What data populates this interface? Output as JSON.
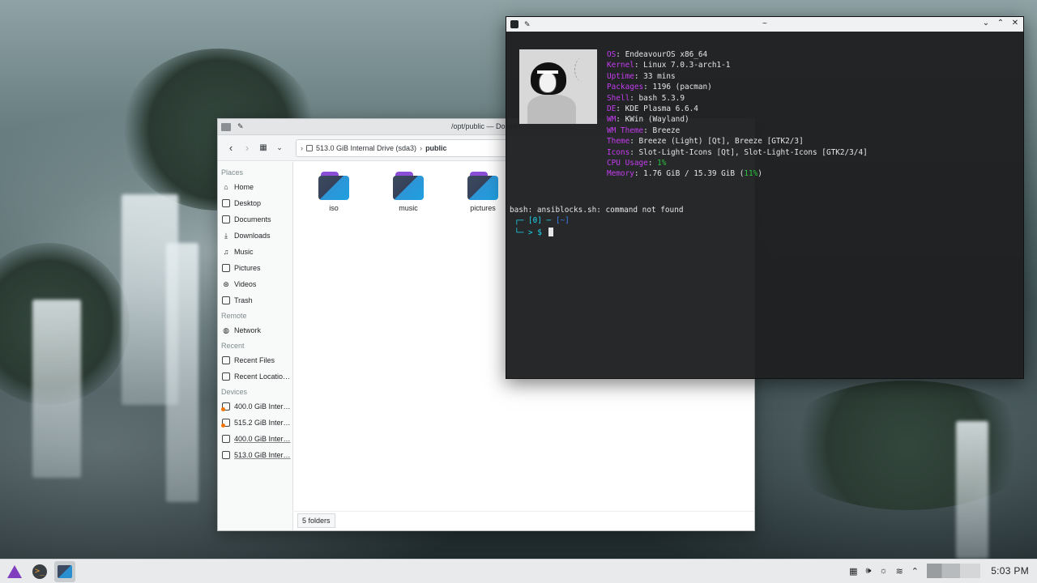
{
  "dolphin": {
    "title": "/opt/public — Dolphin",
    "breadcrumb": {
      "drive": "513.0 GiB Internal Drive (sda3)",
      "current": "public"
    },
    "places": {
      "places_heading": "Places",
      "items": [
        {
          "label": "Home",
          "icon": "home-icon"
        },
        {
          "label": "Desktop",
          "icon": "desktop-icon"
        },
        {
          "label": "Documents",
          "icon": "documents-icon"
        },
        {
          "label": "Downloads",
          "icon": "downloads-icon"
        },
        {
          "label": "Music",
          "icon": "music-icon"
        },
        {
          "label": "Pictures",
          "icon": "pictures-icon"
        },
        {
          "label": "Videos",
          "icon": "videos-icon"
        },
        {
          "label": "Trash",
          "icon": "trash-icon"
        }
      ],
      "remote_heading": "Remote",
      "remote_items": [
        {
          "label": "Network",
          "icon": "network-icon"
        }
      ],
      "recent_heading": "Recent",
      "recent_items": [
        {
          "label": "Recent Files",
          "icon": "recent-files-icon"
        },
        {
          "label": "Recent Locatio…",
          "icon": "recent-locations-icon"
        }
      ],
      "devices_heading": "Devices",
      "devices": [
        {
          "label": "400.0 GiB Inter…",
          "icon": "drive-icon"
        },
        {
          "label": "515.2 GiB Inter…",
          "icon": "drive-icon"
        },
        {
          "label": "400.0 GiB Inter…",
          "icon": "drive-icon"
        },
        {
          "label": "513.0 GiB Inter…",
          "icon": "drive-icon"
        }
      ]
    },
    "folders": [
      {
        "label": "iso"
      },
      {
        "label": "music"
      },
      {
        "label": "pictures"
      }
    ],
    "status": "5 folders"
  },
  "terminal": {
    "title": "~",
    "info": [
      {
        "key": "OS",
        "value": "EndeavourOS x86_64"
      },
      {
        "key": "Kernel",
        "value": "Linux 7.0.3-arch1-1"
      },
      {
        "key": "Uptime",
        "value": "33 mins"
      },
      {
        "key": "Packages",
        "value": "1196 (pacman)"
      },
      {
        "key": "Shell",
        "value": "bash 5.3.9"
      },
      {
        "key": "DE",
        "value": "KDE Plasma 6.6.4"
      },
      {
        "key": "WM",
        "value": "KWin (Wayland)"
      },
      {
        "key": "WM Theme",
        "value": "Breeze"
      },
      {
        "key": "Theme",
        "value": "Breeze (Light) [Qt], Breeze [GTK2/3]"
      },
      {
        "key": "Icons",
        "value": "Slot-Light-Icons [Qt], Slot-Light-Icons [GTK2/3/4]"
      }
    ],
    "cpu": {
      "key": "CPU Usage",
      "value": "1%"
    },
    "memory": {
      "key": "Memory",
      "value": "1.76 GiB / 15.39 GiB (",
      "pct": "11%",
      "close": ")"
    },
    "error_line": "bash: ansiblocks.sh: command not found",
    "prompt": {
      "line1_a": "┌─ [0] ─ ",
      "line1_b": "[~]",
      "line2": "└─ > $ "
    },
    "colors": {
      "key": "#c43cf0",
      "green": "#29c640",
      "cyan": "#1cd6ef"
    }
  },
  "taskbar": {
    "time": "5:03 PM",
    "launchers": [
      "endeavouros-icon",
      "konsole-icon",
      "dolphin-icon"
    ],
    "tray": [
      "keyboard-icon",
      "volume-icon",
      "brightness-icon",
      "wifi-icon",
      "chevron-up-icon"
    ]
  }
}
